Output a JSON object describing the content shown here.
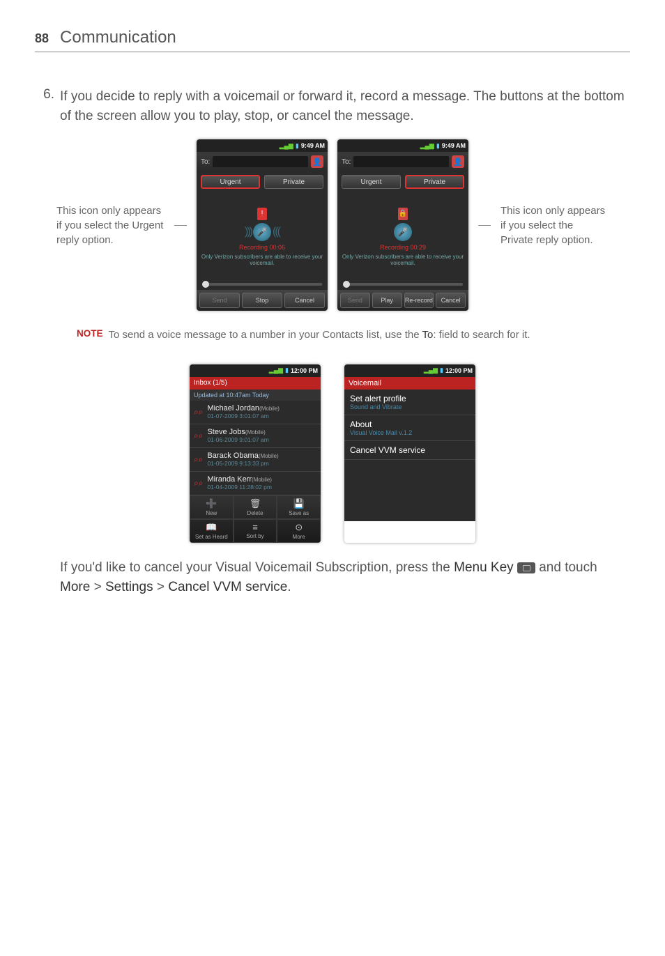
{
  "page": {
    "number": "88",
    "chapter": "Communication"
  },
  "step": {
    "num": "6.",
    "text": "If you decide to reply with a voicemail or forward it, record a message. The buttons at the bottom of the screen allow you to play, stop, or cancel the message."
  },
  "callout_left": "This icon only appears if you select the Urgent reply option.",
  "callout_right": "This icon only appears if you select the Private reply option.",
  "phone_common": {
    "time": "9:49 AM",
    "to_label": "To:",
    "urgent": "Urgent",
    "private": "Private",
    "subscriber_note": "Only Verizon subscribers are able to receive your voicemail."
  },
  "phone_urgent": {
    "recording": "Recording 00:06",
    "buttons": {
      "send": "Send",
      "stop": "Stop",
      "cancel": "Cancel"
    }
  },
  "phone_private": {
    "recording": "Recording 00:29",
    "buttons": {
      "send": "Send",
      "play": "Play",
      "rerecord": "Re-record",
      "cancel": "Cancel"
    }
  },
  "note": {
    "label": "NOTE",
    "text_a": "To send a voice message to a number in your Contacts list, use the ",
    "to_field": "To",
    "text_b": ": field to search for it."
  },
  "inbox": {
    "time": "12:00 PM",
    "header": "Inbox (1/5)",
    "updated": "Updated at 10:47am Today",
    "items": [
      {
        "name": "Michael Jordan",
        "type": "(Mobile)",
        "date": "01-07-2009 3:01:07 am"
      },
      {
        "name": "Steve Jobs",
        "type": "(Mobile)",
        "date": "01-06-2009 9:01:07 am"
      },
      {
        "name": "Barack Obama",
        "type": "(Mobile)",
        "date": "01-05-2009 9:13:33 pm"
      },
      {
        "name": "Miranda Kerr",
        "type": "(Mobile)",
        "date": "01-04-2009 11:28:02 pm"
      }
    ],
    "grid": [
      "New",
      "Delete",
      "Save as",
      "Set as Heard",
      "Sort by",
      "More"
    ]
  },
  "settings": {
    "time": "12:00 PM",
    "header": "Voicemail",
    "items": [
      {
        "title": "Set alert profile",
        "sub": "Sound and Vibrate"
      },
      {
        "title": "About",
        "sub": "Visual Voice Mail v.1.2"
      },
      {
        "title": "Cancel VVM service",
        "sub": ""
      }
    ]
  },
  "closing": {
    "a": "If you'd like to cancel your Visual Voicemail Subscription, press the ",
    "menu_key": "Menu Key",
    "b": " and touch ",
    "more": "More",
    "gt1": " > ",
    "settings": "Settings",
    "gt2": " > ",
    "cancel": "Cancel VVM service",
    "end": "."
  }
}
